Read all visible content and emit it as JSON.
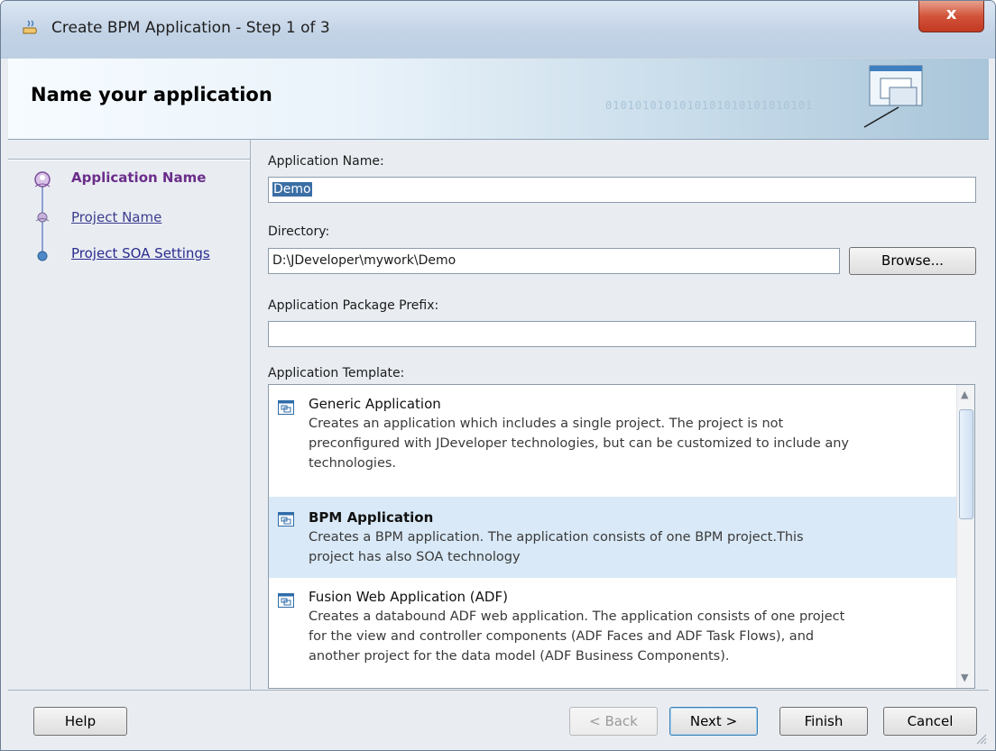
{
  "window": {
    "title": "Create BPM Application - Step 1 of 3",
    "close_label": "x"
  },
  "header": {
    "title": "Name your application",
    "binary_text": "0101010101010101010101010101"
  },
  "steps": [
    {
      "label": "Application Name",
      "state": "current"
    },
    {
      "label": "Project Name",
      "state": "link"
    },
    {
      "label": "Project SOA Settings",
      "state": "link"
    }
  ],
  "form": {
    "app_name_label": "Application Name:",
    "app_name_value": "Demo",
    "directory_label": "Directory:",
    "directory_value": "D:\\JDeveloper\\mywork\\Demo",
    "browse_label": "Browse...",
    "prefix_label": "Application Package Prefix:",
    "prefix_value": "",
    "template_label": "Application Template:"
  },
  "templates": [
    {
      "title": "Generic Application",
      "desc": [
        "Creates an application which includes a single project. The project is not",
        "preconfigured with JDeveloper technologies, but can be customized to include any",
        "technologies."
      ],
      "selected": false
    },
    {
      "title": "BPM Application",
      "desc": [
        "Creates a BPM application. The application consists of one BPM project.This",
        "project has also SOA technology"
      ],
      "selected": true
    },
    {
      "title": "Fusion Web Application (ADF)",
      "desc": [
        "Creates a databound ADF web application. The application consists of one project",
        "for the view and controller components (ADF Faces and ADF Task Flows), and",
        "another project for the data model (ADF Business Components)."
      ],
      "selected": false
    }
  ],
  "footer": {
    "help": "Help",
    "back": "< Back",
    "next": "Next >",
    "finish": "Finish",
    "cancel": "Cancel"
  },
  "colors": {
    "selection": "#3a6ea5",
    "step_current": "#6b2d8a",
    "list_selected": "#d9e9f7"
  }
}
